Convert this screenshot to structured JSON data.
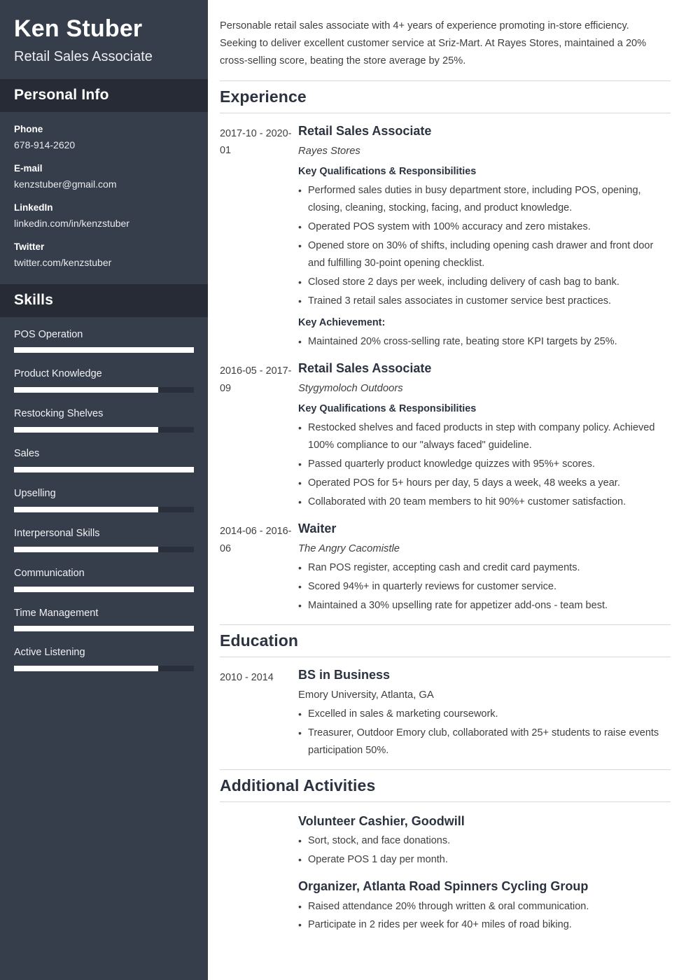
{
  "colors": {
    "sidebar_bg": "#373e4b",
    "sidebar_header_bg": "#262b36",
    "skill_track": "#2a303b",
    "skill_fill": "#ffffff",
    "heading": "#2c3340",
    "body_text": "#3f3f3f",
    "rule": "#d8d8d8"
  },
  "sidebar": {
    "full_name": "Ken Stuber",
    "job_title": "Retail Sales Associate",
    "personal_info": {
      "heading": "Personal Info",
      "items": [
        {
          "label": "Phone",
          "value": "678-914-2620"
        },
        {
          "label": "E-mail",
          "value": "kenzstuber@gmail.com"
        },
        {
          "label": "LinkedIn",
          "value": "linkedin.com/in/kenzstuber"
        },
        {
          "label": "Twitter",
          "value": "twitter.com/kenzstuber"
        }
      ]
    },
    "skills": {
      "heading": "Skills",
      "items": [
        {
          "name": "POS Operation",
          "level": 100
        },
        {
          "name": "Product Knowledge",
          "level": 80
        },
        {
          "name": "Restocking Shelves",
          "level": 80
        },
        {
          "name": "Sales",
          "level": 100
        },
        {
          "name": "Upselling",
          "level": 80
        },
        {
          "name": "Interpersonal Skills",
          "level": 80
        },
        {
          "name": "Communication",
          "level": 100
        },
        {
          "name": "Time Management",
          "level": 100
        },
        {
          "name": "Active Listening",
          "level": 80
        }
      ]
    }
  },
  "main": {
    "summary": "Personable retail sales associate with 4+ years of experience promoting in-store efficiency. Seeking to deliver excellent customer service at Sriz-Mart. At Rayes Stores, maintained a 20% cross-selling score, beating the store average by 25%.",
    "experience": {
      "heading": "Experience",
      "entries": [
        {
          "dates": "2017-10 - 2020-01",
          "role": "Retail Sales Associate",
          "org": "Rayes Stores",
          "subhead": "Key Qualifications & Responsibilities",
          "bullets": [
            "Performed sales duties in busy department store, including POS, opening, closing, cleaning, stocking, facing, and product knowledge.",
            "Operated POS system with 100% accuracy and zero mistakes.",
            "Opened store on 30% of shifts, including opening cash drawer and front door and fulfilling 30-point opening checklist.",
            "Closed store 2 days per week, including delivery of cash bag to bank.",
            "Trained 3 retail sales associates in customer service best practices."
          ],
          "subhead2": "Key Achievement:",
          "bullets2": [
            "Maintained 20% cross-selling rate, beating store KPI targets by 25%."
          ]
        },
        {
          "dates": "2016-05 - 2017-09",
          "role": "Retail Sales Associate",
          "org": "Stygymoloch Outdoors",
          "subhead": "Key Qualifications & Responsibilities",
          "bullets": [
            "Restocked shelves and faced products in step with company policy. Achieved 100% compliance to our \"always faced\" guideline.",
            "Passed quarterly product knowledge quizzes with 95%+ scores.",
            "Operated POS for 5+ hours per day, 5 days a week, 48 weeks a year.",
            "Collaborated with 20 team members to hit 90%+ customer satisfaction."
          ]
        },
        {
          "dates": "2014-06 - 2016-06",
          "role": "Waiter",
          "org": "The Angry Cacomistle",
          "bullets": [
            "Ran POS register, accepting cash and credit card payments.",
            "Scored 94%+ in quarterly reviews for customer service.",
            "Maintained a 30% upselling rate for appetizer add-ons - team best."
          ]
        }
      ]
    },
    "education": {
      "heading": "Education",
      "entries": [
        {
          "dates": "2010 - 2014",
          "role": "BS in Business",
          "org": "Emory University, Atlanta, GA",
          "bullets": [
            "Excelled in sales & marketing coursework.",
            "Treasurer, Outdoor Emory club, collaborated with 25+ students to raise events participation 50%."
          ]
        }
      ]
    },
    "additional_activities": {
      "heading": "Additional Activities",
      "entries": [
        {
          "title": "Volunteer Cashier, Goodwill",
          "bullets": [
            "Sort, stock, and face donations.",
            "Operate POS 1 day per month."
          ]
        },
        {
          "title": "Organizer, Atlanta Road Spinners Cycling Group",
          "bullets": [
            "Raised attendance 20% through written & oral communication.",
            "Participate in 2 rides per week for 40+ miles of road biking."
          ]
        }
      ]
    }
  }
}
